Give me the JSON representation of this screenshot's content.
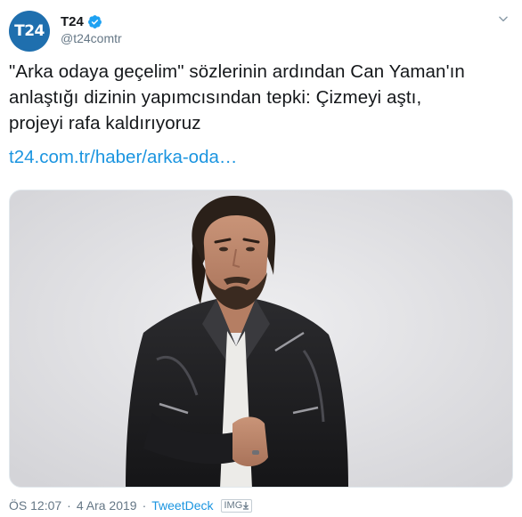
{
  "account": {
    "avatar_text": "T24",
    "display_name": "T24",
    "handle": "@t24comtr",
    "verified_icon": "verified-badge-icon",
    "avatar_color": "#1f6fae"
  },
  "tweet": {
    "text_lines": [
      "\"Arka odaya geçelim\" sözlerinin ardından Can Yaman'ın",
      "anlaştığı dizinin yapımcısından tepki: Çizmeyi aştı,",
      "projeyi rafa kaldırıyoruz"
    ],
    "link": "t24.com.tr/haber/arka-oda…",
    "link_color": "#1b95e0"
  },
  "media": {
    "icon": "photo-man-leather-jacket"
  },
  "footer": {
    "time": "ÖS 12:07",
    "separator": "·",
    "date": "4 Ara 2019",
    "source": "TweetDeck",
    "badge": "IMG"
  },
  "icons": {
    "caret": "chevron-down-icon",
    "badge_arrow": "download-arrow-icon"
  }
}
